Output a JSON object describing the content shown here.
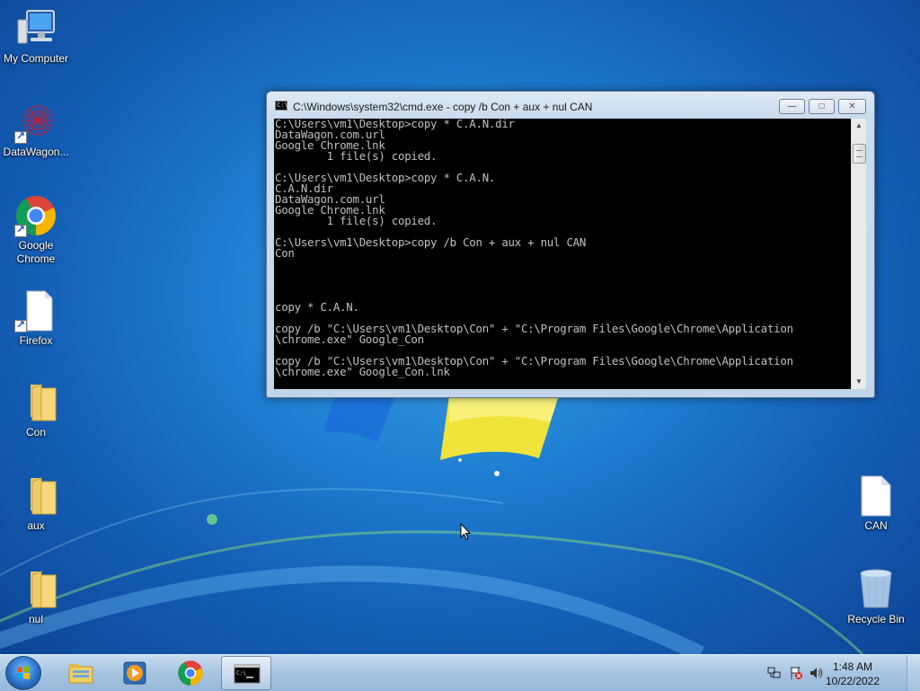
{
  "desktop_icons": [
    {
      "label": "My Computer",
      "icon": "computer-icon"
    },
    {
      "label": "DataWagon...",
      "icon": "datawagon-icon"
    },
    {
      "label": "Google Chrome",
      "icon": "chrome-icon"
    },
    {
      "label": "Firefox",
      "icon": "blank-file-icon"
    },
    {
      "label": "Con",
      "icon": "folder-icon"
    },
    {
      "label": "aux",
      "icon": "folder-icon"
    },
    {
      "label": "nul",
      "icon": "folder-icon"
    },
    {
      "label": "CAN",
      "icon": "blank-file-icon"
    },
    {
      "label": "Recycle Bin",
      "icon": "recycle-bin-icon"
    }
  ],
  "cmd": {
    "title": "C:\\Windows\\system32\\cmd.exe - copy  /b Con + aux + nul CAN",
    "buttons": {
      "minimize": "—",
      "maximize": "□",
      "close": "✕"
    },
    "lines": [
      "C:\\Users\\vm1\\Desktop>copy * C.A.N.dir",
      "DataWagon.com.url",
      "Google Chrome.lnk",
      "        1 file(s) copied.",
      "",
      "C:\\Users\\vm1\\Desktop>copy * C.A.N.",
      "C.A.N.dir",
      "DataWagon.com.url",
      "Google Chrome.lnk",
      "        1 file(s) copied.",
      "",
      "C:\\Users\\vm1\\Desktop>copy /b Con + aux + nul CAN",
      "Con",
      "",
      "",
      "",
      "",
      "copy * C.A.N.",
      "",
      "copy /b \"C:\\Users\\vm1\\Desktop\\Con\" + \"C:\\Program Files\\Google\\Chrome\\Application",
      "\\chrome.exe\" Google_Con",
      "",
      "copy /b \"C:\\Users\\vm1\\Desktop\\Con\" + \"C:\\Program Files\\Google\\Chrome\\Application",
      "\\chrome.exe\" Google_Con.lnk"
    ]
  },
  "taskbar": {
    "pinned": [
      "explorer-icon",
      "media-player-icon",
      "chrome-icon",
      "cmd-icon"
    ],
    "tray_icons": [
      "network-icon",
      "action-center-flag-icon",
      "volume-icon"
    ],
    "clock": {
      "time": "1:48 AM",
      "date": "10/22/2022"
    }
  },
  "colors": {
    "accent": "#1f7fd2",
    "console_bg": "#000000",
    "console_fg": "#c0c0c0"
  }
}
